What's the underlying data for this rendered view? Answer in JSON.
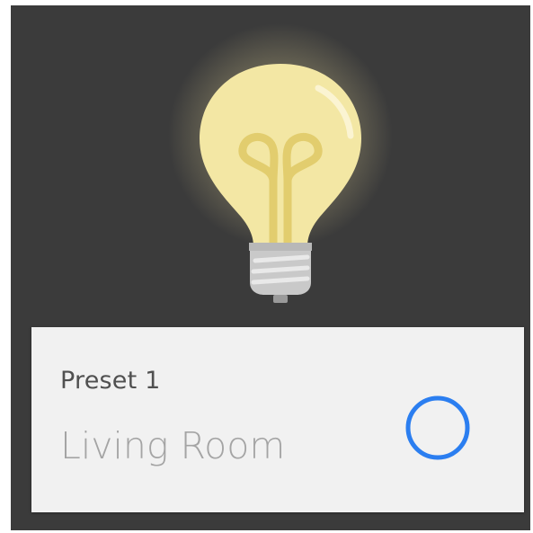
{
  "card": {
    "subtitle": "Preset 1",
    "title": "Living Room"
  },
  "icons": {
    "background_art": "lightbulb-icon",
    "action": "circle-outline-icon"
  },
  "colors": {
    "screen_background": "#3b3b3b",
    "bulb_glass": "#f3e7a4",
    "bulb_glow": "#f7e6a0",
    "filament": "#e2cd6e",
    "base": "#c9c9c9",
    "card_background": "#f1f1f1",
    "accent": "#2b7ef0"
  }
}
